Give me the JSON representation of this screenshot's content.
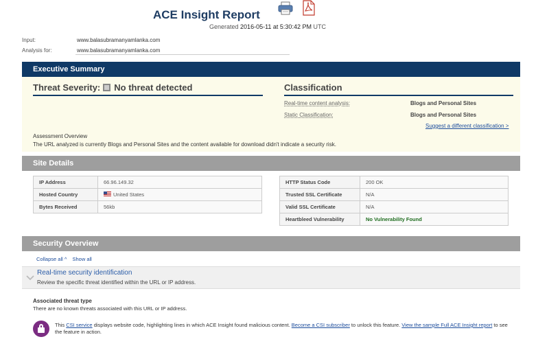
{
  "header": {
    "title": "ACE Insight Report",
    "generated_prefix": "Generated",
    "generated_date": "2016-05-11 at 5:30:42 PM",
    "generated_tz": "UTC",
    "print_icon": "printer-icon",
    "pdf_icon": "pdf-icon"
  },
  "input": {
    "input_label": "Input:",
    "input_value": "www.balasubramanyamlanka.com",
    "analysis_label": "Analysis for:",
    "analysis_value": "www.balasubramanyamlanka.com"
  },
  "executive_summary": {
    "bar_label": "Executive Summary",
    "threat_label": "Threat Severity:",
    "threat_value": "No threat detected",
    "classification_title": "Classification",
    "rows": [
      {
        "label": "Real-time content analysis:",
        "value": "Blogs and Personal Sites"
      },
      {
        "label": "Static Classification:",
        "value": "Blogs and Personal Sites"
      }
    ],
    "suggest_link": "Suggest a different classification >",
    "assessment_title": "Assessment Overview",
    "assessment_text": "The URL analyzed is currently Blogs and Personal Sites and the content available for download didn't indicate a security risk."
  },
  "site_details": {
    "bar_label": "Site Details",
    "left_table": [
      {
        "key": "IP Address",
        "value": "66.96.149.32"
      },
      {
        "key": "Hosted Country",
        "value": "United States"
      },
      {
        "key": "Bytes Received",
        "value": "56kb"
      }
    ],
    "right_table": [
      {
        "key": "HTTP Status Code",
        "value": "200 OK"
      },
      {
        "key": "Trusted SSL Certificate",
        "value": "N/A"
      },
      {
        "key": "Valid SSL Certificate",
        "value": "N/A"
      },
      {
        "key": "Heartbleed Vulnerability",
        "value": "No Vulnerability Found"
      }
    ]
  },
  "security_overview": {
    "bar_label": "Security Overview",
    "collapse_all": "Collapse all ^",
    "show_all": "Show all",
    "realtime_title": "Real-time security identification",
    "realtime_sub": "Review the specific threat identified within the URL or IP address.",
    "assoc_title": "Associated threat type",
    "assoc_text": "There are no known threats associated with this URL or IP address.",
    "csi": {
      "t1": "This ",
      "link1": "CSI service",
      "t2": " displays website code, highlighting lines in which ACE Insight found malicious content. ",
      "link2": "Become a CSI subscriber",
      "t3": " to unlock this feature. ",
      "link3": "View the sample Full ACE Insight report",
      "t4": " to see the feature in action."
    }
  }
}
